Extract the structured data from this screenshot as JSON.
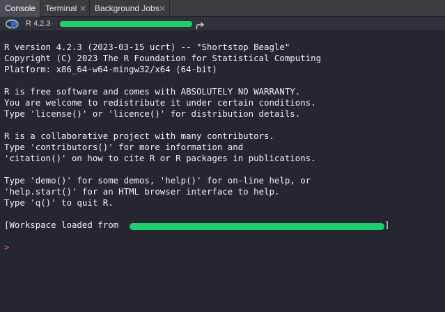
{
  "tabs": [
    {
      "label": "Console",
      "active": true,
      "closable": false
    },
    {
      "label": "Terminal",
      "active": false,
      "closable": true
    },
    {
      "label": "Background Jobs",
      "active": false,
      "closable": true
    }
  ],
  "subbar": {
    "r_version": "R 4.2.3",
    "path_prefix": "·",
    "path_icon": "goto-directory-arrow-icon"
  },
  "console": {
    "lines": [
      "R version 4.2.3 (2023-03-15 ucrt) -- \"Shortstop Beagle\"",
      "Copyright (C) 2023 The R Foundation for Statistical Computing",
      "Platform: x86_64-w64-mingw32/x64 (64-bit)",
      "R is free software and comes with ABSOLUTELY NO WARRANTY.",
      "You are welcome to redistribute it under certain conditions.",
      "Type 'license()' or 'licence()' for distribution details.",
      "R is a collaborative project with many contributors.",
      "Type 'contributors()' for more information and",
      "'citation()' on how to cite R or R packages in publications.",
      "Type 'demo()' for some demos, 'help()' for on-line help, or",
      "'help.start()' for an HTML browser interface to help.",
      "Type 'q()' to quit R."
    ],
    "workspace_prefix": "[Workspace loaded from",
    "workspace_suffix": "]",
    "prompt": ">",
    "input_value": ""
  },
  "colors": {
    "background": "#262630",
    "text": "#f0f0f2",
    "prompt": "#e05a8c",
    "redaction": "#1fcf6f",
    "tab_bar": "#3b3c40",
    "active_tab": "#4c4d55"
  }
}
